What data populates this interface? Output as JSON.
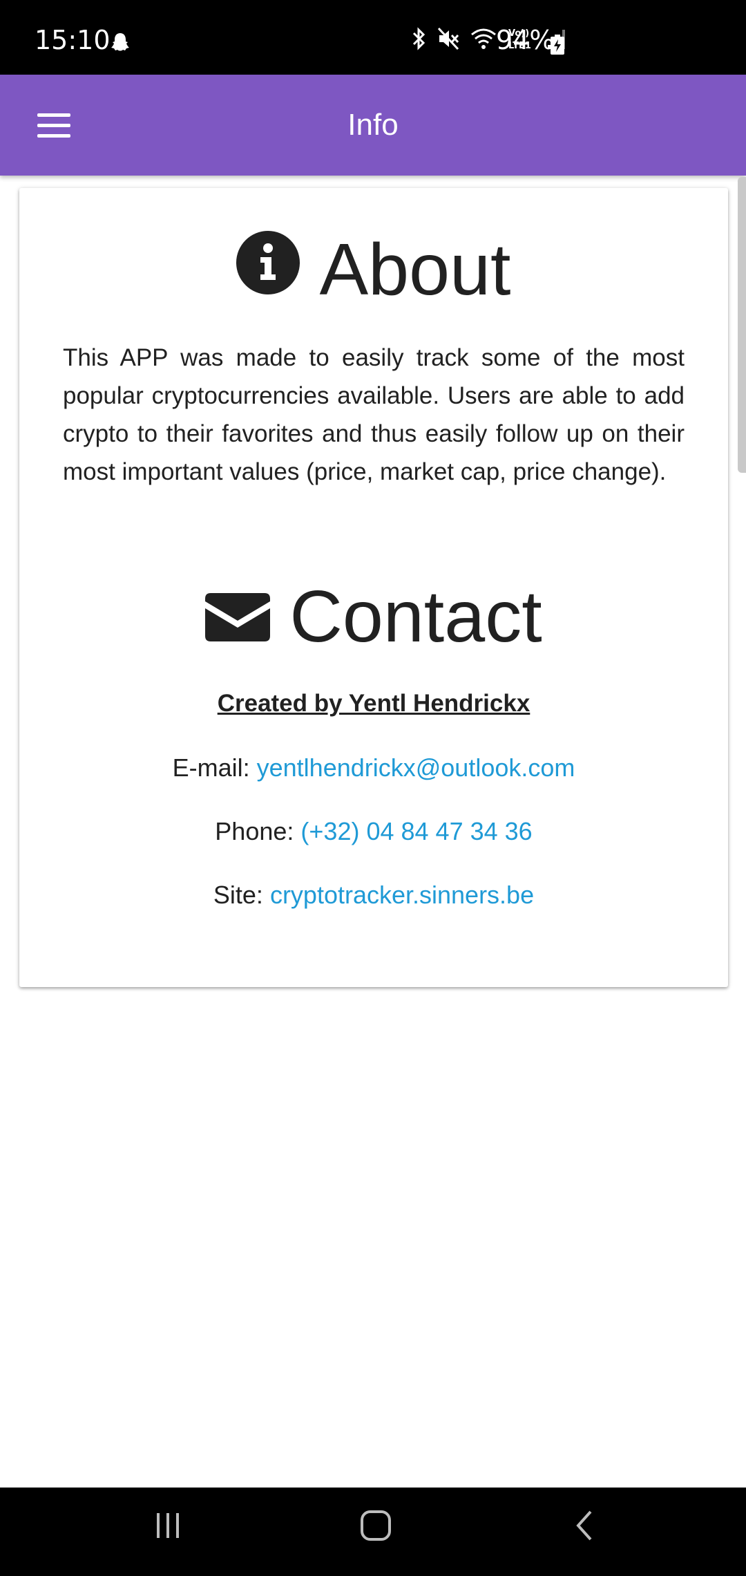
{
  "status_bar": {
    "time": "15:10",
    "battery_percent": "94%",
    "icons": [
      "snapchat-ghost-icon",
      "bluetooth-icon",
      "mute-icon",
      "wifi-icon",
      "volte-lte1-icon",
      "signal-icon",
      "battery-charging-icon"
    ],
    "volte_label": "Vo)) LTE1"
  },
  "app_bar": {
    "title": "Info",
    "menu_icon": "hamburger-menu-icon",
    "background_color": "#7e57c2"
  },
  "about": {
    "icon": "info-circle-icon",
    "heading": "About",
    "text": "This APP was made to easily track some of the most popular cryptocurrencies available. Users are able to add crypto to their favorites and thus easily follow up on their most important values (price, market cap, price change)."
  },
  "contact": {
    "icon": "envelope-icon",
    "heading": "Contact",
    "created_by": "Created by Yentl Hendrickx",
    "email_label": "E-mail:",
    "email_value": "yentlhendrickx@outlook.com",
    "phone_label": "Phone:",
    "phone_value": "(+32) 04 84 47 34 36",
    "site_label": "Site:",
    "site_value": "cryptotracker.sinners.be",
    "link_color": "#1f9ad6"
  },
  "nav_bar": {
    "buttons": [
      "recent-apps-icon",
      "home-icon",
      "back-icon"
    ]
  }
}
